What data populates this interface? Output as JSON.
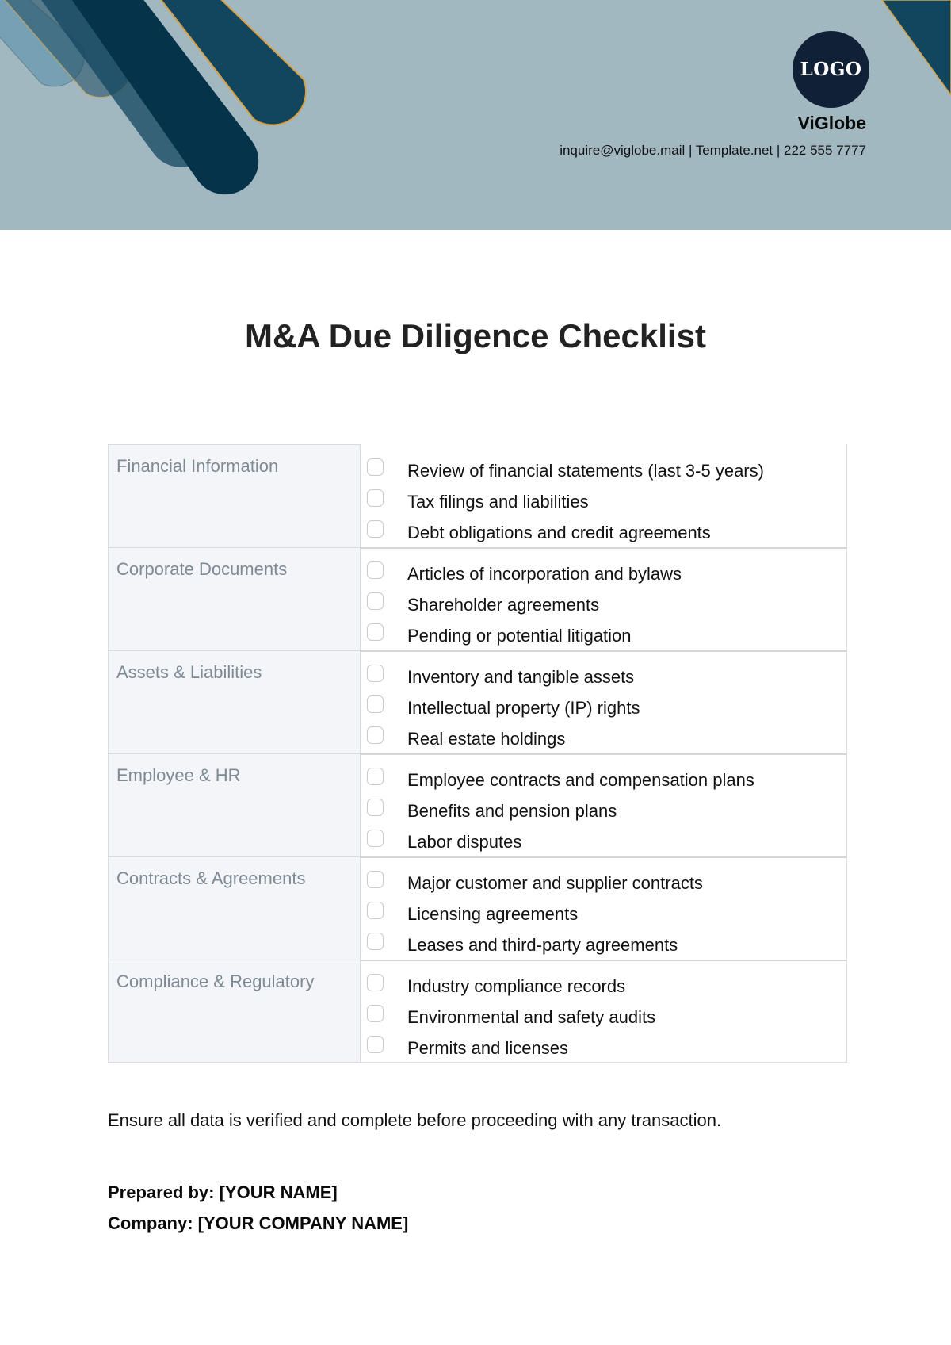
{
  "header": {
    "logo_text": "LOGO",
    "company_name": "ViGlobe",
    "contact": "inquire@viglobe.mail | Template.net | 222 555 7777",
    "colors": {
      "background": "#a2b8c1",
      "dark_teal": "#12465f",
      "deep_teal": "#05344a",
      "light_blue": "#6f9db3",
      "accent_gold": "#d9a043",
      "logo_navy": "#0f2037"
    }
  },
  "document": {
    "title": "M&A Due Diligence Checklist"
  },
  "checklist": [
    {
      "category": "Financial Information",
      "items": [
        {
          "label": "Review of financial statements (last 3-5 years)",
          "checked": false
        },
        {
          "label": "Tax filings and liabilities",
          "checked": false
        },
        {
          "label": "Debt obligations and credit agreements",
          "checked": false
        }
      ]
    },
    {
      "category": "Corporate Documents",
      "items": [
        {
          "label": "Articles of incorporation and bylaws",
          "checked": false
        },
        {
          "label": "Shareholder agreements",
          "checked": false
        },
        {
          "label": "Pending or potential litigation",
          "checked": false
        }
      ]
    },
    {
      "category": "Assets & Liabilities",
      "items": [
        {
          "label": "Inventory and tangible assets",
          "checked": false
        },
        {
          "label": "Intellectual property (IP) rights",
          "checked": false
        },
        {
          "label": "Real estate holdings",
          "checked": false
        }
      ]
    },
    {
      "category": "Employee & HR",
      "items": [
        {
          "label": "Employee contracts and compensation plans",
          "checked": false
        },
        {
          "label": "Benefits and pension plans",
          "checked": false
        },
        {
          "label": "Labor disputes",
          "checked": false
        }
      ]
    },
    {
      "category": "Contracts & Agreements",
      "items": [
        {
          "label": "Major customer and supplier contracts",
          "checked": false
        },
        {
          "label": "Licensing agreements",
          "checked": false
        },
        {
          "label": "Leases and third-party agreements",
          "checked": false
        }
      ]
    },
    {
      "category": "Compliance & Regulatory",
      "items": [
        {
          "label": "Industry compliance records",
          "checked": false
        },
        {
          "label": "Environmental and safety audits",
          "checked": false
        },
        {
          "label": "Permits and licenses",
          "checked": false
        }
      ]
    }
  ],
  "footer": {
    "note": "Ensure all data is verified and complete before proceeding with any transaction.",
    "prepared_by": "Prepared by: [YOUR NAME]",
    "company": "Company: [YOUR COMPANY NAME]"
  }
}
